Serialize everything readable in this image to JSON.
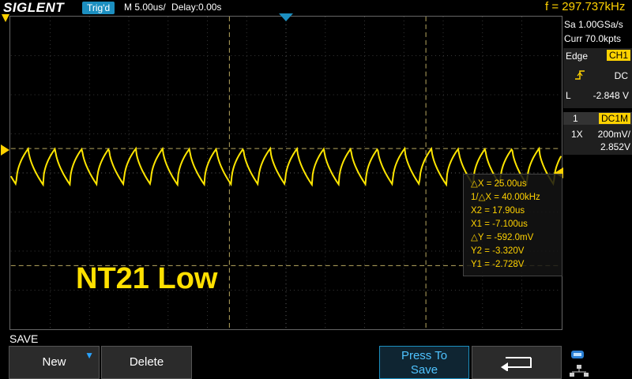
{
  "header": {
    "logo": "SIGLENT",
    "trigger_status": "Trig'd",
    "timebase": "M 5.00us/",
    "delay": "Delay:0.00s",
    "frequency": "f = 297.737kHz"
  },
  "acquire": {
    "sample_rate": "Sa 1.00GSa/s",
    "memory": "Curr 70.0kpts"
  },
  "trigger": {
    "type": "Edge",
    "source": "CH1",
    "coupling": "DC",
    "level_label": "L",
    "level": "-2.848 V"
  },
  "channel": {
    "number": "1",
    "coupling": "DC1M",
    "probe": "1X",
    "scale": "200mV/",
    "offset": "2.852V"
  },
  "cursors": {
    "dx": "△X = 25.00us",
    "inv_dx": "1/△X = 40.00kHz",
    "x2": "X2 = 17.90us",
    "x1": "X1 = -7.100us",
    "dy": "△Y = -592.0mV",
    "y2": "Y2 = -3.320V",
    "y1": "Y1 = -2.728V"
  },
  "overlay_label": "NT21 Low",
  "menu": {
    "title": "SAVE",
    "new_label": "New",
    "delete_label": "Delete",
    "press_label_1": "Press To",
    "press_label_2": "Save"
  },
  "colors": {
    "trace": "#ffe600",
    "accent": "#1c8fc0",
    "text_yellow": "#ffd200"
  },
  "icons": {
    "trigger_edge": "rising-edge-icon",
    "back": "return-arrow-icon",
    "network": "network-icon"
  }
}
